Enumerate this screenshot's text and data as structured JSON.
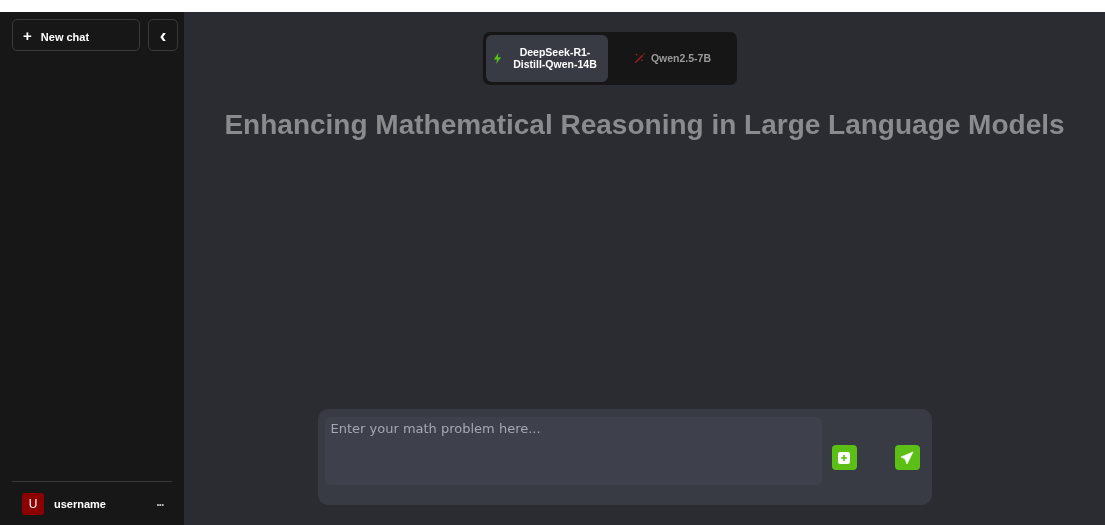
{
  "sidebar": {
    "new_chat": {
      "icon": "+",
      "label": "New chat"
    },
    "collapse": "‹",
    "user": {
      "initial": "U",
      "name": "username",
      "menu": "•••"
    }
  },
  "model_tabs": [
    {
      "label": "DeepSeek-R1-Distill-Qwen-14B",
      "selected": true
    },
    {
      "label": "Qwen2.5-7B",
      "selected": false
    }
  ],
  "title": "Enhancing Mathematical Reasoning in Large Language Models",
  "composer": {
    "placeholder": "Enter your math problem here..."
  }
}
